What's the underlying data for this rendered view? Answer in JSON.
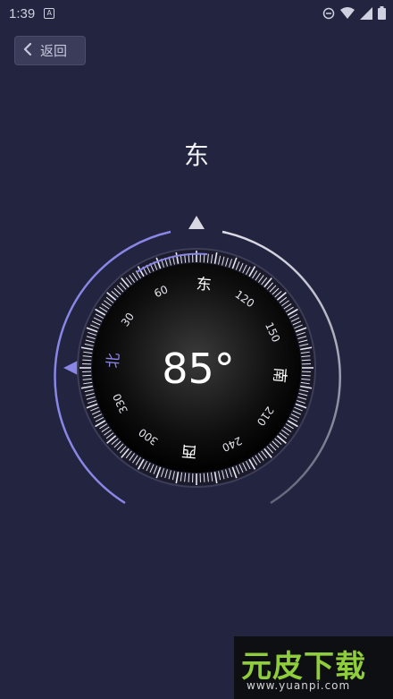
{
  "status_bar": {
    "time": "1:39",
    "left_icon": "A",
    "right_icons": [
      "do-not-disturb-icon",
      "wifi-icon",
      "cell-signal-icon",
      "battery-icon"
    ]
  },
  "header": {
    "back_label": "返回"
  },
  "compass": {
    "direction": "东",
    "heading_display": "85°",
    "heading_degrees": 85,
    "cardinal_labels": {
      "north": "北",
      "east": "东",
      "south": "南",
      "west": "西"
    },
    "degree_labels": [
      "30",
      "60",
      "120",
      "150",
      "210",
      "240",
      "300",
      "330"
    ],
    "colors": {
      "accent": "#8a86e6",
      "ring_light": "#dcdce8",
      "dial_center": "#3a3a3a",
      "dial_edge": "#000000"
    }
  },
  "watermark": {
    "logo_text": "元皮下载",
    "url": "www.yuanpi.com"
  }
}
